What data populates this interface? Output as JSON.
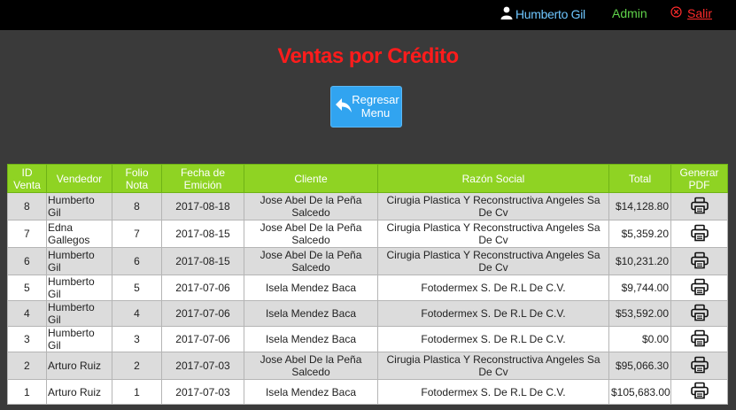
{
  "header": {
    "user_name": "Humberto Gil",
    "role": "Admin",
    "logout_label": "Salir"
  },
  "page_title": "Ventas por Crédito",
  "back_button": {
    "label_line1": "Regresar",
    "label_line2": "Menu"
  },
  "table": {
    "headers": [
      "ID Venta",
      "Vendedor",
      "Folio Nota",
      "Fecha de Emición",
      "Cliente",
      "Razón Social",
      "Total",
      "Generar PDF"
    ],
    "rows": [
      {
        "id": "8",
        "vendedor": "Humberto Gil",
        "folio": "8",
        "fecha": "2017-08-18",
        "cliente": "Jose Abel De la Peña Salcedo",
        "razon": "Cirugia Plastica Y Reconstructiva Angeles Sa De Cv",
        "total": "$14,128.80"
      },
      {
        "id": "7",
        "vendedor": "Edna Gallegos",
        "folio": "7",
        "fecha": "2017-08-15",
        "cliente": "Jose Abel De la Peña Salcedo",
        "razon": "Cirugia Plastica Y Reconstructiva Angeles Sa De Cv",
        "total": "$5,359.20"
      },
      {
        "id": "6",
        "vendedor": "Humberto Gil",
        "folio": "6",
        "fecha": "2017-08-15",
        "cliente": "Jose Abel De la Peña Salcedo",
        "razon": "Cirugia Plastica Y Reconstructiva Angeles Sa De Cv",
        "total": "$10,231.20"
      },
      {
        "id": "5",
        "vendedor": "Humberto Gil",
        "folio": "5",
        "fecha": "2017-07-06",
        "cliente": "Isela Mendez Baca",
        "razon": "Fotodermex S. De R.L De C.V.",
        "total": "$9,744.00"
      },
      {
        "id": "4",
        "vendedor": "Humberto Gil",
        "folio": "4",
        "fecha": "2017-07-06",
        "cliente": "Isela Mendez Baca",
        "razon": "Fotodermex S. De R.L De C.V.",
        "total": "$53,592.00"
      },
      {
        "id": "3",
        "vendedor": "Humberto Gil",
        "folio": "3",
        "fecha": "2017-07-06",
        "cliente": "Isela Mendez Baca",
        "razon": "Fotodermex S. De R.L De C.V.",
        "total": "$0.00"
      },
      {
        "id": "2",
        "vendedor": "Arturo Ruiz",
        "folio": "2",
        "fecha": "2017-07-03",
        "cliente": "Jose Abel De la Peña Salcedo",
        "razon": "Cirugia Plastica Y Reconstructiva Angeles Sa De Cv",
        "total": "$95,066.30"
      },
      {
        "id": "1",
        "vendedor": "Arturo Ruiz",
        "folio": "1",
        "fecha": "2017-07-03",
        "cliente": "Isela Mendez Baca",
        "razon": "Fotodermex S. De R.L De C.V.",
        "total": "$105,683.00"
      }
    ]
  },
  "colors": {
    "header_bg": "#8fd323",
    "title": "#ff1c1c",
    "button": "#31a4f0",
    "user": "#6ec6ff",
    "role": "#5fd34a",
    "logout": "#ff2b2b"
  },
  "icons": {
    "user": "user-icon",
    "logout": "close-circle-icon",
    "back": "reply-arrow-icon",
    "pdf": "printer-icon"
  }
}
